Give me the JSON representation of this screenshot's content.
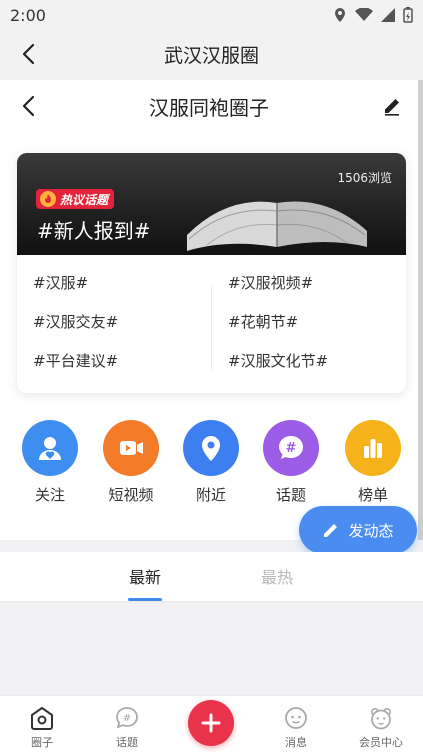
{
  "status_bar": {
    "time": "2:00"
  },
  "header": {
    "title": "武汉汉服圈"
  },
  "sub_header": {
    "title": "汉服同袍圈子"
  },
  "featured_topic": {
    "badge": "热议话题",
    "title": "#新人报到#",
    "views": "1506浏览"
  },
  "topics": [
    "#汉服#",
    "#汉服视频#",
    "#汉服交友#",
    "#花朝节#",
    "#平台建议#",
    "#汉服文化节#"
  ],
  "quick_nav": [
    {
      "label": "关注",
      "icon": "person-heart-icon",
      "color": "#3d8ef0"
    },
    {
      "label": "短视频",
      "icon": "video-camera-icon",
      "color": "#f47b2a"
    },
    {
      "label": "附近",
      "icon": "location-pin-icon",
      "color": "#3d7ff0"
    },
    {
      "label": "话题",
      "icon": "hashtag-icon",
      "color": "#9b5de5"
    },
    {
      "label": "榜单",
      "icon": "bar-chart-icon",
      "color": "#f5b21a"
    }
  ],
  "post_button": {
    "label": "发动态"
  },
  "feed_tabs": [
    {
      "label": "最新",
      "active": true
    },
    {
      "label": "最热",
      "active": false
    }
  ],
  "bottom_nav": [
    {
      "label": "圈子",
      "icon": "circle-home-icon"
    },
    {
      "label": "话题",
      "icon": "topic-bubble-icon"
    },
    {
      "label": "消息",
      "icon": "message-face-icon"
    },
    {
      "label": "会员中心",
      "icon": "member-bear-icon"
    }
  ]
}
